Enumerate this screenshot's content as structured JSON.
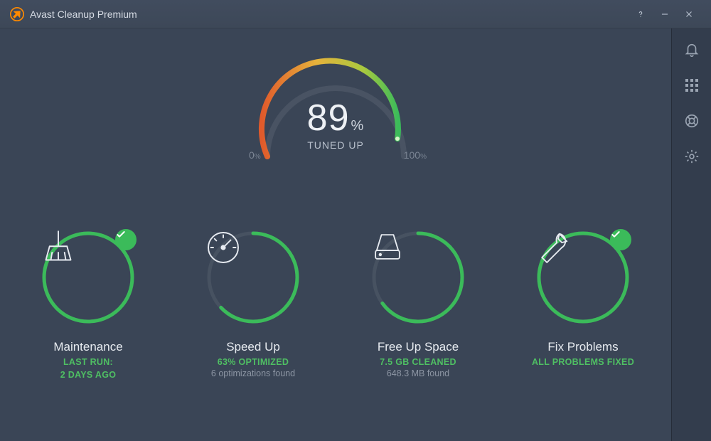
{
  "app": {
    "title": "Avast Cleanup Premium"
  },
  "gauge": {
    "value": "89",
    "unit": "%",
    "caption": "TUNED UP",
    "min_label": "0",
    "max_label": "100",
    "pct_suffix": "%",
    "fill_pct": 89
  },
  "cards": [
    {
      "title": "Maintenance",
      "green_line": "LAST RUN:",
      "grey_line": "2 DAYS AGO",
      "grey_is_green": true,
      "progress": 100,
      "badge": true,
      "icon": "broom"
    },
    {
      "title": "Speed Up",
      "green_line": "63% OPTIMIZED",
      "grey_line": "6 optimizations found",
      "grey_is_green": false,
      "progress": 63,
      "badge": false,
      "icon": "speedometer"
    },
    {
      "title": "Free Up Space",
      "green_line": "7.5 GB CLEANED",
      "grey_line": "648.3 MB found",
      "grey_is_green": false,
      "progress": 65,
      "badge": false,
      "icon": "hdd"
    },
    {
      "title": "Fix Problems",
      "green_line": "ALL PROBLEMS FIXED",
      "grey_line": "",
      "grey_is_green": false,
      "progress": 100,
      "badge": true,
      "icon": "wrench"
    }
  ],
  "sidebar": {
    "notifications": "Notifications",
    "apps": "Apps",
    "help": "Help",
    "settings": "Settings"
  }
}
